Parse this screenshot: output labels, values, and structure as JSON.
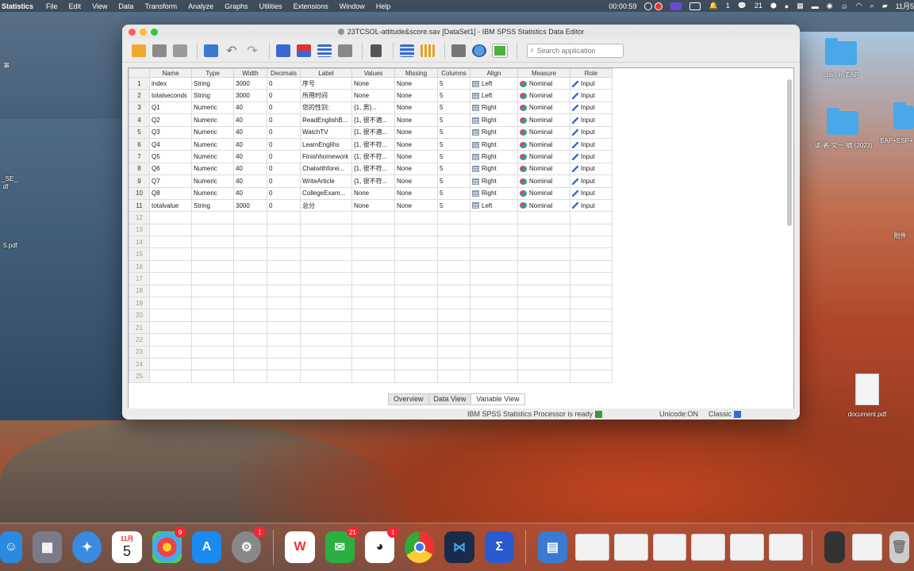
{
  "menubar": {
    "app": "Statistics",
    "items": [
      "File",
      "Edit",
      "View",
      "Data",
      "Transform",
      "Analyze",
      "Graphs",
      "Utilities",
      "Extensions",
      "Window",
      "Help"
    ],
    "timer": "00:00:59",
    "notif_count": "1",
    "chat_count": "21",
    "date": "11月5"
  },
  "desktop": {
    "icons": [
      {
        "label": "curri. in EAP"
      },
      {
        "label": "读·者·文一·摘 (2023)"
      },
      {
        "label": "EAP+ESP+"
      },
      {
        "label": "附件 ·"
      },
      {
        "label": "document.pdf"
      }
    ],
    "left_labels": [
      "事",
      "_SE_",
      "df",
      "5.pdf"
    ]
  },
  "window": {
    "title": "23TCSOL-attitude&score.sav [DataSet1] - IBM SPSS Statistics Data Editor",
    "search_placeholder": "Search application",
    "columns": [
      "Name",
      "Type",
      "Width",
      "Decimals",
      "Label",
      "Values",
      "Missing",
      "Columns",
      "Align",
      "Measure",
      "Role"
    ],
    "rows": [
      {
        "n": "1",
        "name": "index",
        "type": "String",
        "width": "3000",
        "decimals": "0",
        "label": "序号",
        "values": "None",
        "missing": "None",
        "columns": "5",
        "align": "Left",
        "measure": "Nominal",
        "role": "Input"
      },
      {
        "n": "2",
        "name": "totalseconds",
        "type": "String",
        "width": "3000",
        "decimals": "0",
        "label": "所用时间",
        "values": "None",
        "missing": "None",
        "columns": "5",
        "align": "Left",
        "measure": "Nominal",
        "role": "Input"
      },
      {
        "n": "3",
        "name": "Q1",
        "type": "Numeric",
        "width": "40",
        "decimals": "0",
        "label": "您的性别:",
        "values": "{1, 男}...",
        "missing": "None",
        "columns": "5",
        "align": "Right",
        "measure": "Nominal",
        "role": "Input"
      },
      {
        "n": "4",
        "name": "Q2",
        "type": "Numeric",
        "width": "40",
        "decimals": "0",
        "label": "ReadEnglishB...",
        "values": "{1, 很不適...",
        "missing": "None",
        "columns": "5",
        "align": "Right",
        "measure": "Nominal",
        "role": "Input"
      },
      {
        "n": "5",
        "name": "Q3",
        "type": "Numeric",
        "width": "40",
        "decimals": "0",
        "label": "WatchTV",
        "values": "{1, 很不適...",
        "missing": "None",
        "columns": "5",
        "align": "Right",
        "measure": "Nominal",
        "role": "Input"
      },
      {
        "n": "6",
        "name": "Q4",
        "type": "Numeric",
        "width": "40",
        "decimals": "0",
        "label": "LearnEnglihs",
        "values": "{1, 很不符...",
        "missing": "None",
        "columns": "5",
        "align": "Right",
        "measure": "Nominal",
        "role": "Input"
      },
      {
        "n": "7",
        "name": "Q5",
        "type": "Numeric",
        "width": "40",
        "decimals": "0",
        "label": "Finishhomework",
        "values": "{1, 很不符...",
        "missing": "None",
        "columns": "5",
        "align": "Right",
        "measure": "Nominal",
        "role": "Input"
      },
      {
        "n": "8",
        "name": "Q6",
        "type": "Numeric",
        "width": "40",
        "decimals": "0",
        "label": "Chatwithforei...",
        "values": "{1, 很不符...",
        "missing": "None",
        "columns": "5",
        "align": "Right",
        "measure": "Nominal",
        "role": "Input"
      },
      {
        "n": "9",
        "name": "Q7",
        "type": "Numeric",
        "width": "40",
        "decimals": "0",
        "label": "WriteArticle",
        "values": "{1, 很不符...",
        "missing": "None",
        "columns": "5",
        "align": "Right",
        "measure": "Nominal",
        "role": "Input"
      },
      {
        "n": "10",
        "name": "Q8",
        "type": "Numeric",
        "width": "40",
        "decimals": "0",
        "label": "CollegeExam...",
        "values": "None",
        "missing": "None",
        "columns": "5",
        "align": "Right",
        "measure": "Nominal",
        "role": "Input"
      },
      {
        "n": "11",
        "name": "totalvalue",
        "type": "String",
        "width": "3000",
        "decimals": "0",
        "label": "总分",
        "values": "None",
        "missing": "None",
        "columns": "5",
        "align": "Left",
        "measure": "Nominal",
        "role": "Input"
      }
    ],
    "empty_rows": [
      "12",
      "13",
      "14",
      "15",
      "16",
      "17",
      "18",
      "19",
      "20",
      "21",
      "22",
      "23",
      "24",
      "25"
    ],
    "tabs": [
      "Overview",
      "Data View",
      "Variable View"
    ],
    "active_tab": "Variable View",
    "status": {
      "processor": "IBM SPSS Statistics Processor is ready",
      "unicode": "Unicode:ON",
      "mode": "Classic"
    }
  },
  "dock": {
    "calendar_month": "11月",
    "calendar_day": "5",
    "photos_badge": "9",
    "settings_badge": "1",
    "wechat_badge": "21",
    "qq_badge": "1"
  },
  "colors": {
    "accent": "#4a90d9",
    "badge": "#ff2233"
  }
}
